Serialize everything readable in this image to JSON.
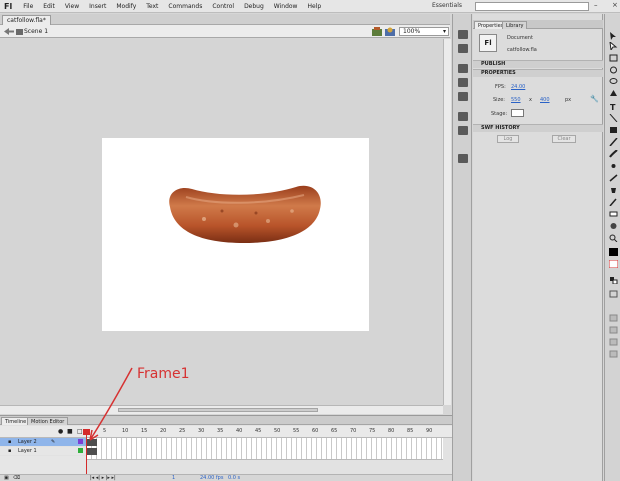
{
  "app": {
    "logo": "Fl",
    "workspace": "Essentials"
  },
  "menu": [
    "File",
    "Edit",
    "View",
    "Insert",
    "Modify",
    "Text",
    "Commands",
    "Control",
    "Debug",
    "Window",
    "Help"
  ],
  "document_tab": {
    "label": "catfollow.fla*"
  },
  "scene": {
    "label": "Scene 1",
    "zoom": "100%"
  },
  "timeline": {
    "tabs": [
      "Timeline",
      "Motion Editor"
    ],
    "ruler": [
      "5",
      "10",
      "15",
      "20",
      "25",
      "30",
      "35",
      "40",
      "45",
      "50",
      "55",
      "60",
      "65",
      "70",
      "75",
      "80",
      "85",
      "90"
    ],
    "layers": [
      {
        "name": "Layer 2",
        "selected": true
      },
      {
        "name": "Layer 1",
        "selected": false
      }
    ],
    "status": {
      "frame": "1",
      "fps": "24.00 fps",
      "time": "0.0 s"
    }
  },
  "properties": {
    "tabs": [
      "Properties",
      "Library"
    ],
    "doc_type": "Document",
    "doc_icon": "Fl",
    "doc_name": "catfollow.fla",
    "sections": {
      "publish": "PUBLISH",
      "properties": "PROPERTIES",
      "swf_history": "SWF HISTORY"
    },
    "fps_label": "FPS:",
    "fps_value": "24.00",
    "size_label": "Size:",
    "width": "550",
    "x": "x",
    "height": "400",
    "unit": "px",
    "stage_label": "Stage:",
    "log_button": "Log",
    "clear_button": "Clear"
  },
  "annotation": {
    "text": "Frame1"
  },
  "colors": {
    "accent": "#2a62c6",
    "selected_layer": "#8fb5ea",
    "playhead": "#d42a2a",
    "annotation": "#d63232",
    "sausage": "#b8542a"
  }
}
